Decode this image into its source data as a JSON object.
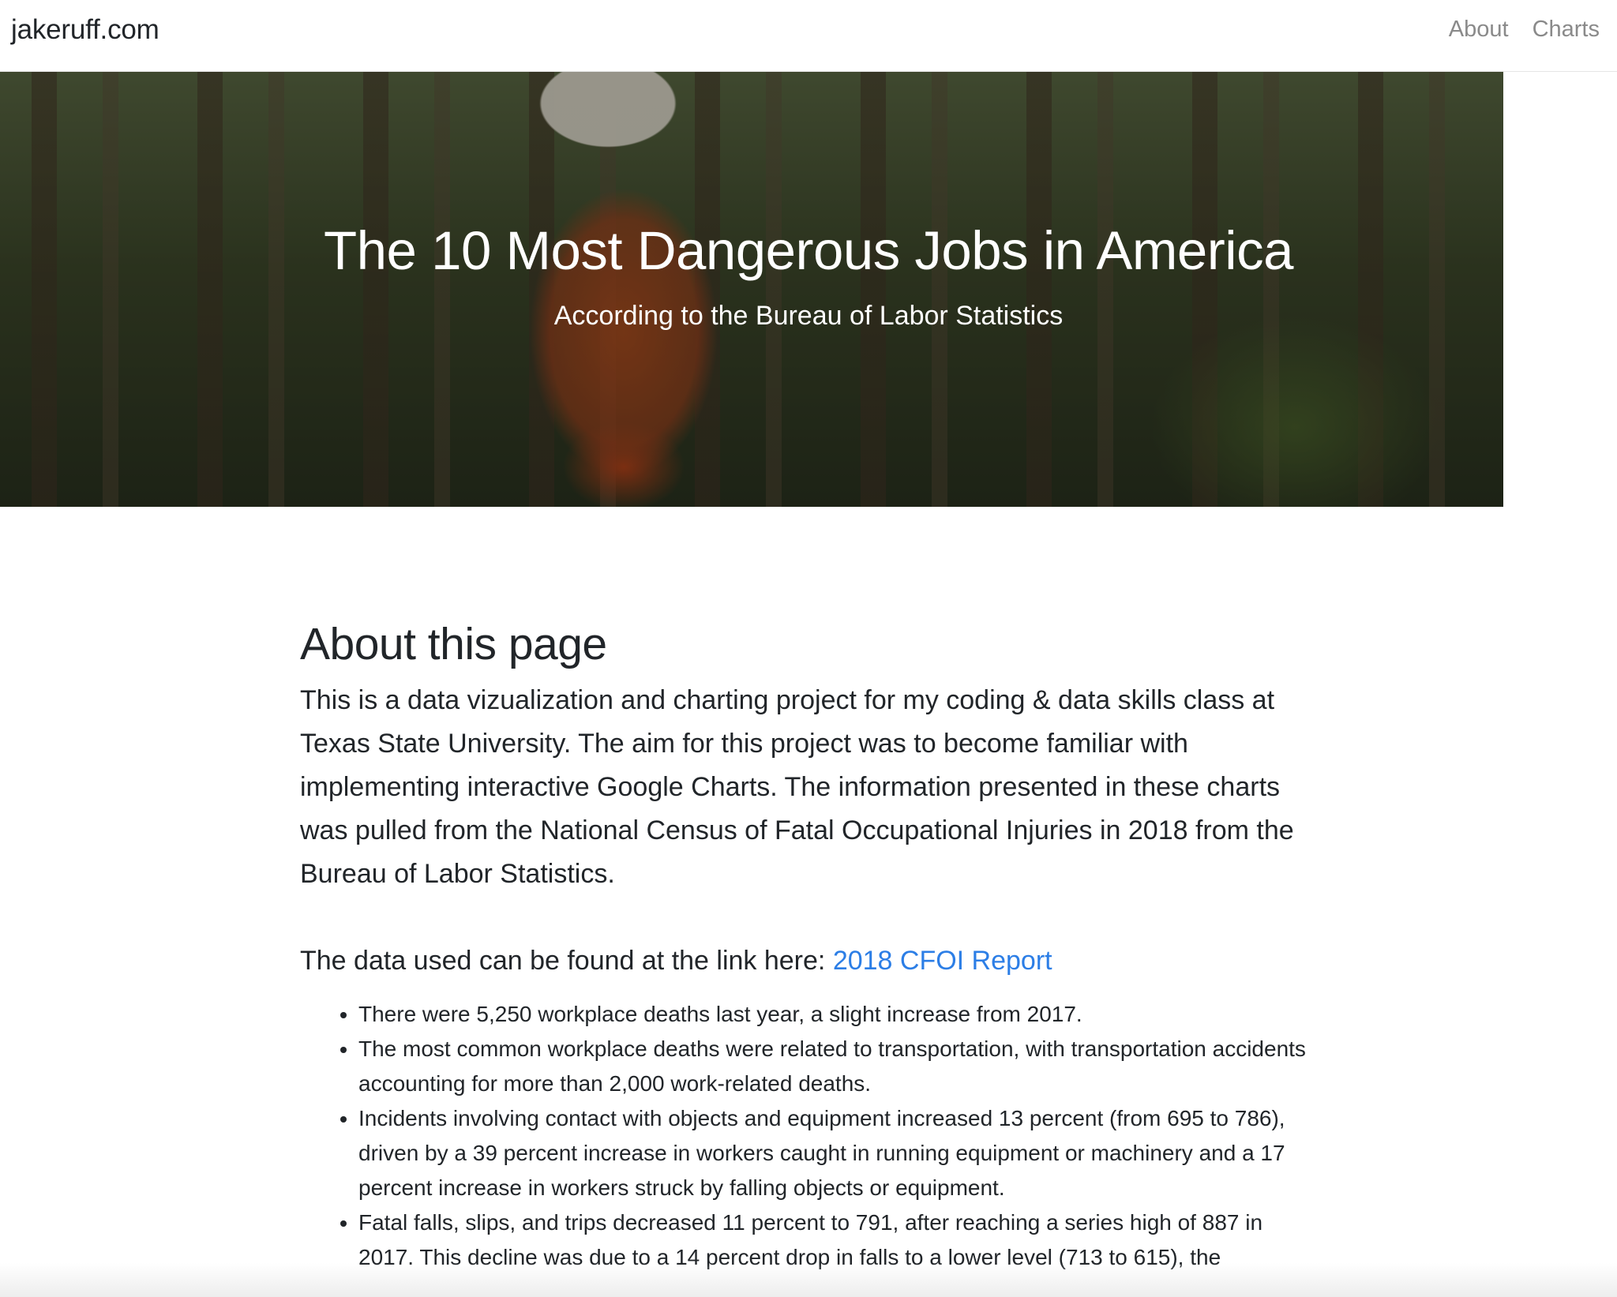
{
  "navbar": {
    "brand": "jakeruff.com",
    "links": [
      {
        "label": "About"
      },
      {
        "label": "Charts"
      }
    ]
  },
  "hero": {
    "title": "The 10 Most Dangerous Jobs in America",
    "subtitle": "According to the Bureau of Labor Statistics"
  },
  "about": {
    "heading": "About this page",
    "intro": "This is a data vizualization and charting project for my coding & data skills class at Texas State University. The aim for this project was to become familiar with implementing interactive Google Charts. The information presented in these charts was pulled from the National Census of Fatal Occupational Injuries in 2018 from the Bureau of Labor Statistics.",
    "data_prefix": "The data used can be found at the link here: ",
    "data_link": "2018 CFOI Report",
    "facts": [
      "There were 5,250 workplace deaths last year, a slight increase from 2017.",
      "The most common workplace deaths were related to transportation, with transportation accidents accounting for more than 2,000 work-related deaths.",
      "Incidents involving contact with objects and equipment increased 13 percent (from 695 to 786), driven by a 39 percent increase in workers caught in running equipment or machinery and a 17 percent increase in workers struck by falling objects or equipment.",
      "Fatal falls, slips, and trips decreased 11 percent to 791, after reaching a series high of 887 in 2017. This decline was due to a 14 percent drop in falls to a lower level (713 to 615), the"
    ]
  }
}
